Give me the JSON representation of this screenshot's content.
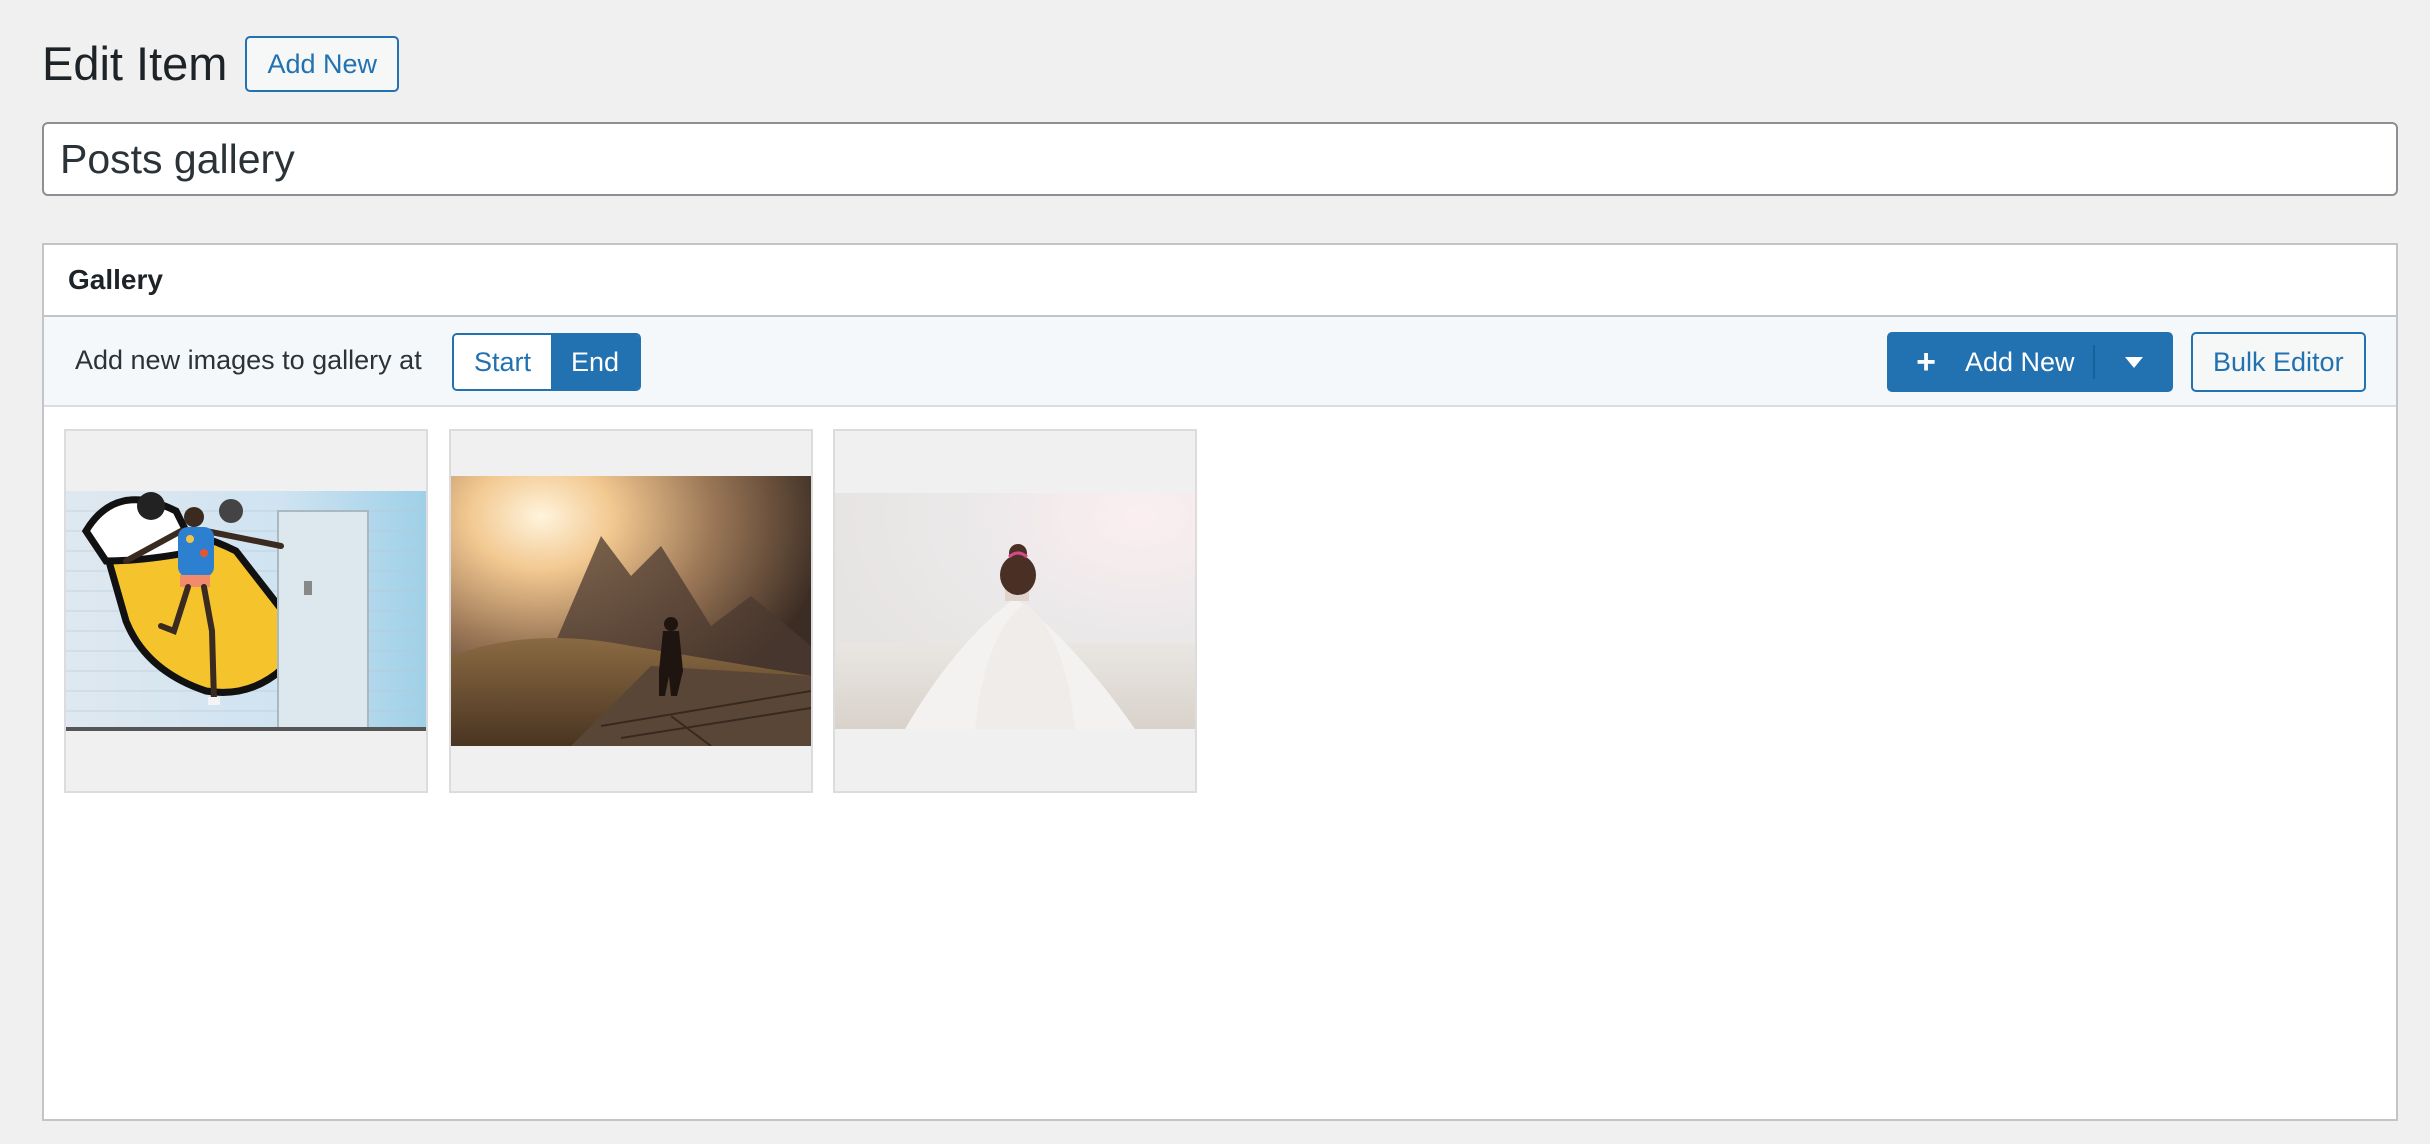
{
  "page": {
    "title": "Edit Item",
    "add_new_label": "Add New"
  },
  "post_title": {
    "value": "Posts gallery"
  },
  "gallery_box": {
    "title": "Gallery",
    "toolbar": {
      "insert_label": "Add new images to gallery at",
      "position_options": [
        "Start",
        "End"
      ],
      "selected_position": "End",
      "add_new_label": "Add New",
      "add_new_icon": "plus-icon",
      "dropdown_icon": "caret-down-icon",
      "bulk_editor_label": "Bulk Editor"
    },
    "images": [
      {
        "subject": "graffiti-wall-dancer"
      },
      {
        "subject": "mountain-sunset-hiker"
      },
      {
        "subject": "woman-in-fog"
      }
    ]
  },
  "colors": {
    "accent": "#2271b1",
    "background": "#f0f0f1"
  }
}
